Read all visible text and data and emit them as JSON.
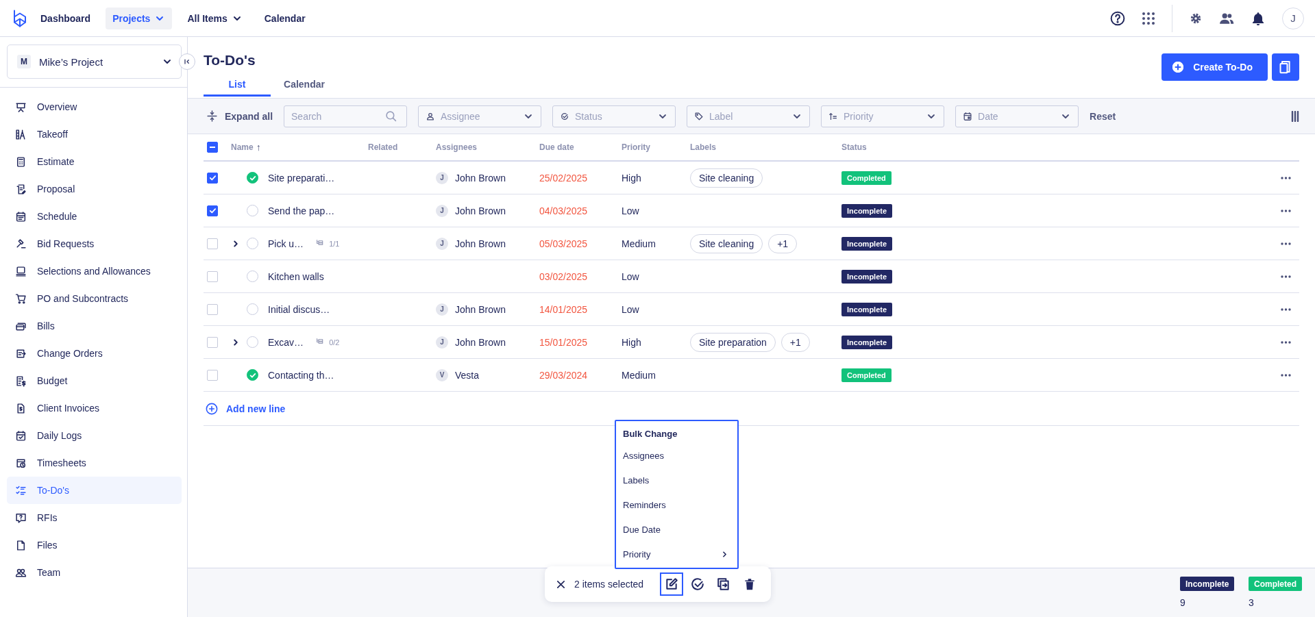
{
  "nav": {
    "items": [
      {
        "label": "Dashboard",
        "selected": false,
        "has_menu": false
      },
      {
        "label": "Projects",
        "selected": true,
        "has_menu": true
      },
      {
        "label": "All Items",
        "selected": false,
        "has_menu": true
      },
      {
        "label": "Calendar",
        "selected": false,
        "has_menu": false
      }
    ],
    "avatar": "J"
  },
  "project": {
    "initial": "M",
    "name": "Mike’s Project"
  },
  "sidebar": {
    "items": [
      {
        "label": "Overview",
        "selected": false
      },
      {
        "label": "Takeoff",
        "selected": false
      },
      {
        "label": "Estimate",
        "selected": false
      },
      {
        "label": "Proposal",
        "selected": false
      },
      {
        "label": "Schedule",
        "selected": false
      },
      {
        "label": "Bid Requests",
        "selected": false
      },
      {
        "label": "Selections and Allowances",
        "selected": false
      },
      {
        "label": "PO and Subcontracts",
        "selected": false
      },
      {
        "label": "Bills",
        "selected": false
      },
      {
        "label": "Change Orders",
        "selected": false
      },
      {
        "label": "Budget",
        "selected": false
      },
      {
        "label": "Client Invoices",
        "selected": false
      },
      {
        "label": "Daily Logs",
        "selected": false
      },
      {
        "label": "Timesheets",
        "selected": false
      },
      {
        "label": "To-Do's",
        "selected": true
      },
      {
        "label": "RFIs",
        "selected": false
      },
      {
        "label": "Files",
        "selected": false
      },
      {
        "label": "Team",
        "selected": false
      }
    ]
  },
  "page": {
    "title": "To-Do's",
    "create_button": "Create To-Do"
  },
  "tabs": [
    {
      "label": "List",
      "selected": true
    },
    {
      "label": "Calendar",
      "selected": false
    }
  ],
  "filters": {
    "expand_all": "Expand all",
    "search": {
      "placeholder": "Search"
    },
    "dropdowns": [
      {
        "kind": "assignee",
        "placeholder": "Assignee"
      },
      {
        "kind": "status",
        "placeholder": "Status"
      },
      {
        "kind": "label",
        "placeholder": "Label"
      },
      {
        "kind": "priority",
        "placeholder": "Priority"
      },
      {
        "kind": "date",
        "placeholder": "Date"
      }
    ],
    "reset": "Reset"
  },
  "table": {
    "indeterminate": true,
    "columns": [
      {
        "label": "Name",
        "sort_arrow": "↑"
      },
      {
        "label": "Related"
      },
      {
        "label": "Assignees"
      },
      {
        "label": "Due date"
      },
      {
        "label": "Priority"
      },
      {
        "label": "Labels"
      },
      {
        "label": "Status"
      }
    ],
    "rows": [
      {
        "checked": true,
        "completed": true,
        "expandable": false,
        "name": "Site preparati…",
        "assignee": {
          "initial": "J",
          "name": "John Brown"
        },
        "due_date": "25/02/2025",
        "overdue": true,
        "priority": "High",
        "labels": [
          "Site cleaning"
        ],
        "status": {
          "label": "Completed",
          "kind": "completed"
        }
      },
      {
        "checked": true,
        "completed": false,
        "expandable": false,
        "name": "Send the pap…",
        "assignee": {
          "initial": "J",
          "name": "John Brown"
        },
        "due_date": "04/03/2025",
        "overdue": true,
        "priority": "Low",
        "labels": [],
        "status": {
          "label": "Incomplete",
          "kind": "incomplete"
        }
      },
      {
        "checked": false,
        "completed": false,
        "expandable": true,
        "name": "Pick u…",
        "subtasks": "1/1",
        "assignee": {
          "initial": "J",
          "name": "John Brown"
        },
        "due_date": "05/03/2025",
        "overdue": true,
        "priority": "Medium",
        "labels": [
          "Site cleaning"
        ],
        "more_labels": "+1",
        "status": {
          "label": "Incomplete",
          "kind": "incomplete"
        }
      },
      {
        "checked": false,
        "completed": false,
        "expandable": false,
        "name": "Kitchen walls",
        "due_date": "03/02/2025",
        "overdue": true,
        "priority": "Low",
        "labels": [],
        "status": {
          "label": "Incomplete",
          "kind": "incomplete"
        }
      },
      {
        "checked": false,
        "completed": false,
        "expandable": false,
        "name": "Initial discus…",
        "assignee": {
          "initial": "J",
          "name": "John Brown"
        },
        "due_date": "14/01/2025",
        "overdue": true,
        "priority": "Low",
        "labels": [],
        "status": {
          "label": "Incomplete",
          "kind": "incomplete"
        }
      },
      {
        "checked": false,
        "completed": false,
        "expandable": true,
        "name": "Excav…",
        "subtasks": "0/2",
        "assignee": {
          "initial": "J",
          "name": "John Brown"
        },
        "due_date": "15/01/2025",
        "overdue": true,
        "priority": "High",
        "labels": [
          "Site preparation"
        ],
        "more_labels": "+1",
        "status": {
          "label": "Incomplete",
          "kind": "incomplete"
        }
      },
      {
        "checked": false,
        "completed": true,
        "expandable": false,
        "name": "Contacting th…",
        "assignee": {
          "initial": "V",
          "name": "Vesta"
        },
        "due_date": "29/03/2024",
        "overdue": true,
        "priority": "Medium",
        "labels": [],
        "status": {
          "label": "Completed",
          "kind": "completed"
        }
      }
    ],
    "add_line": "Add new line"
  },
  "bulk_menu": {
    "title": "Bulk Change",
    "items": [
      {
        "label": "Assignees",
        "has_submenu": false
      },
      {
        "label": "Labels",
        "has_submenu": false
      },
      {
        "label": "Reminders",
        "has_submenu": false
      },
      {
        "label": "Due Date",
        "has_submenu": false
      },
      {
        "label": "Priority",
        "has_submenu": true
      }
    ]
  },
  "selection_bar": {
    "text": "2 items selected",
    "actions": [
      {
        "kind": "edit",
        "selected": true
      },
      {
        "kind": "complete",
        "selected": false
      },
      {
        "kind": "duplicate",
        "selected": false
      },
      {
        "kind": "delete",
        "selected": false
      }
    ]
  },
  "summary": [
    {
      "label": "Incomplete",
      "kind": "incomplete",
      "count": "9"
    },
    {
      "label": "Completed",
      "kind": "completed",
      "count": "3"
    }
  ]
}
